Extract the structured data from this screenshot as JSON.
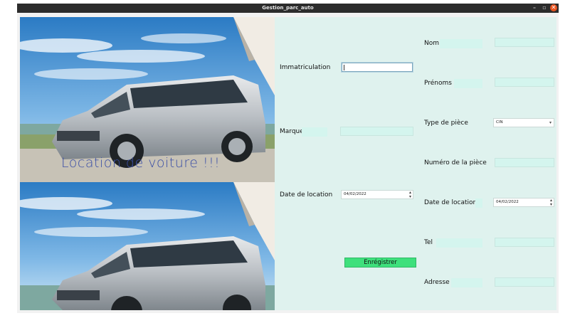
{
  "window": {
    "title": "Gestion_parc_auto",
    "min_glyph": "–",
    "max_glyph": "▫",
    "close_glyph": "✕"
  },
  "banner": {
    "overlay_text": "Location de voiture !!!"
  },
  "form_left": {
    "immatriculation_label": "Immatriculation",
    "immatriculation_value": "",
    "marque_label": "Marque",
    "marque_value": "",
    "date_location_label": "Date de location",
    "date_location_value": "04/02/2022",
    "save_label": "Enrégistrer"
  },
  "form_right": {
    "nom_label": "Nom",
    "prenoms_label": "Prénoms",
    "type_piece_label": "Type de pièce",
    "type_piece_value": "CIN",
    "numero_piece_label": "Numéro de la pièce",
    "date_location_label": "Date de location",
    "date_location_value": "04/02/2022",
    "tel_label": "Tel",
    "adresse_label": "Adresse"
  },
  "colors": {
    "panel_bg": "#dff2ee",
    "field_bg": "#d4f5ee",
    "button_bg": "#3ee07c",
    "overlay_text": "#3b4fa6",
    "titlebar_bg": "#2c2c2c",
    "close_button": "#e95420"
  }
}
